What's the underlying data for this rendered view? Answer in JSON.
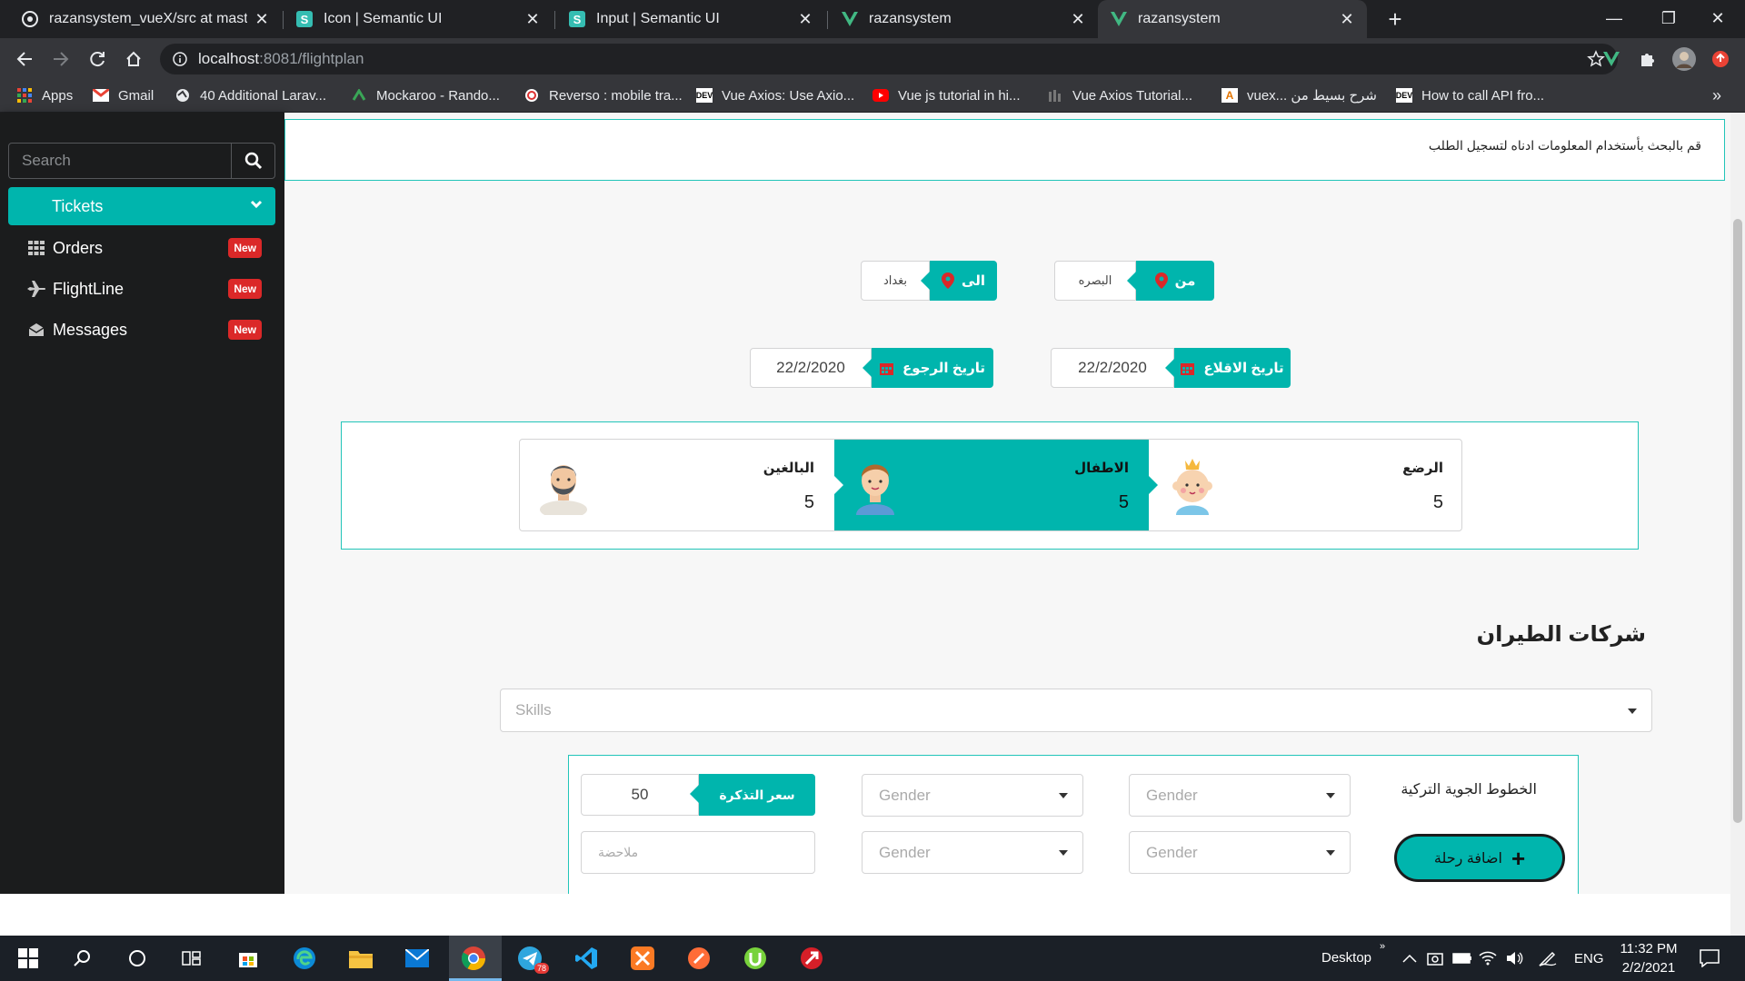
{
  "browser": {
    "tabs": [
      {
        "title": "razansystem_vueX/src at master",
        "icon": "github-icon"
      },
      {
        "title": "Icon | Semantic UI",
        "icon": "semantic-ui-icon"
      },
      {
        "title": "Input | Semantic UI",
        "icon": "semantic-ui-icon"
      },
      {
        "title": "razansystem",
        "icon": "vue-icon"
      },
      {
        "title": "razansystem",
        "icon": "vue-icon"
      }
    ],
    "address": {
      "host": "localhost",
      "path": ":8081/flightplan"
    },
    "bookmarks": [
      "Apps",
      "Gmail",
      "40 Additional Larav...",
      "Mockaroo - Rando...",
      "Reverso : mobile tra...",
      "Vue Axios: Use Axio...",
      "Vue js tutorial in hi...",
      "Vue Axios Tutorial...",
      "vuex... شرح بسيط من",
      "How to call API fro..."
    ],
    "bookmark_overflow": "»"
  },
  "sidebar": {
    "search_placeholder": "Search",
    "tickets_label": "Tickets",
    "items": [
      {
        "label": "Orders",
        "badge": "New",
        "icon": "grid-icon"
      },
      {
        "label": "FlightLine",
        "badge": "New",
        "icon": "plane-icon"
      },
      {
        "label": "Messages",
        "badge": "New",
        "icon": "inbox-icon"
      }
    ]
  },
  "main": {
    "notice": "قم بالبحث بأستخدام المعلومات ادناه لتسجيل الطلب",
    "to": {
      "label": "الى",
      "value": "بغداد"
    },
    "from": {
      "label": "من",
      "value": "البصره"
    },
    "return_date": {
      "label": "تاريخ الرجوع",
      "value": "22/2/2020"
    },
    "departure_date": {
      "label": "تاريخ الاقلاع",
      "value": "22/2/2020"
    },
    "passengers": [
      {
        "label": "الرضع",
        "count": "5",
        "icon": "infant-avatar-icon"
      },
      {
        "label": "الاطفال",
        "count": "5",
        "icon": "child-avatar-icon",
        "selected": true
      },
      {
        "label": "البالغين",
        "count": "5",
        "icon": "adult-avatar-icon"
      }
    ],
    "airlines_title": "شركات الطيران",
    "skills_placeholder": "Skills",
    "airline_card": {
      "name": "الخطوط الجوية التركية",
      "ticket_price_label": "سعر التذكرة",
      "ticket_price_value": "50",
      "gender_placeholder": "Gender",
      "note_placeholder": "ملاحضة",
      "add_trip_label": "اضافة رحلة"
    }
  },
  "taskbar": {
    "desktop_label": "Desktop",
    "language": "ENG",
    "time": "11:32 PM",
    "date": "2/2/2021",
    "telegram_badge": "78"
  },
  "colors": {
    "accent": "#00b5ad",
    "danger": "#db2828",
    "sidebar": "#1b1c1d"
  }
}
